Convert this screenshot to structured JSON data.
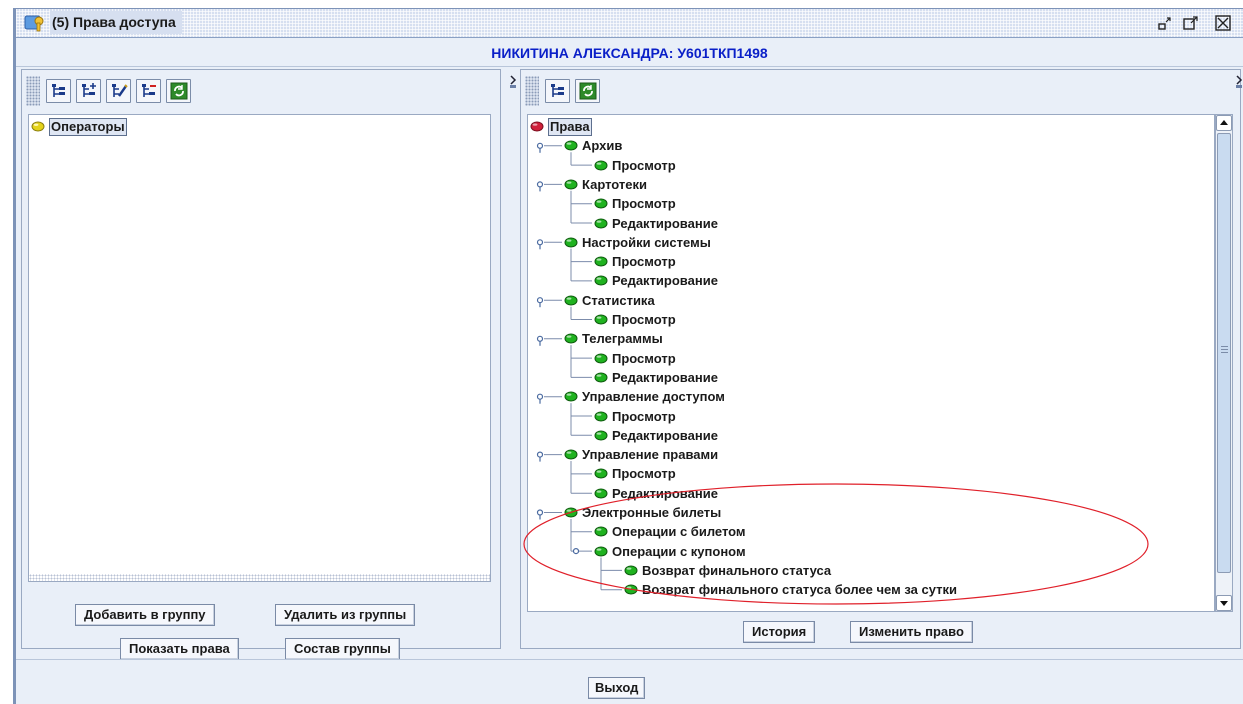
{
  "window": {
    "title": "(5) Права доступа",
    "user_header": "НИКИТИНА АЛЕКСАНДРА: У601ТКП1498"
  },
  "left_panel": {
    "tree_root": "Операторы",
    "buttons": {
      "add_to_group": "Добавить в группу",
      "remove_from_group": "Удалить из группы",
      "show_rights": "Показать права",
      "group_members": "Состав группы"
    }
  },
  "right_panel": {
    "tree": [
      {
        "label": "Права"
      },
      {
        "label": "Архив"
      },
      {
        "label": "Просмотр"
      },
      {
        "label": "Картотеки"
      },
      {
        "label": "Просмотр"
      },
      {
        "label": "Редактирование"
      },
      {
        "label": "Настройки системы"
      },
      {
        "label": "Просмотр"
      },
      {
        "label": "Редактирование"
      },
      {
        "label": "Статистика"
      },
      {
        "label": "Просмотр"
      },
      {
        "label": "Телеграммы"
      },
      {
        "label": "Просмотр"
      },
      {
        "label": "Редактирование"
      },
      {
        "label": "Управление доступом"
      },
      {
        "label": "Просмотр"
      },
      {
        "label": "Редактирование"
      },
      {
        "label": "Управление правами"
      },
      {
        "label": "Просмотр"
      },
      {
        "label": "Редактирование"
      },
      {
        "label": "Электронные билеты"
      },
      {
        "label": "Операции с билетом"
      },
      {
        "label": "Операции с купоном"
      },
      {
        "label": "Возврат финального статуса"
      },
      {
        "label": "Возврат финального статуса более чем за сутки"
      }
    ],
    "buttons": {
      "history": "История",
      "change_right": "Изменить право"
    }
  },
  "footer": {
    "exit": "Выход"
  },
  "colors": {
    "title_blue": "#0a1fc8",
    "node_green": "#1fb21f",
    "node_red": "#d0203a",
    "node_yellow": "#e3d21a",
    "annotation_red": "#e0202a"
  }
}
